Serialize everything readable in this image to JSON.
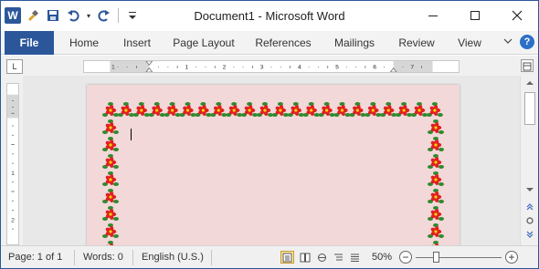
{
  "app": {
    "doc_name": "Document1",
    "separator": " - ",
    "app_name": "Microsoft Word",
    "word_icon_letter": "W"
  },
  "quick_access": {
    "icons": [
      "word-logo",
      "format-painter-icon",
      "save-icon",
      "undo-icon",
      "redo-icon",
      "customize-qat-icon"
    ]
  },
  "window_controls": {
    "minimize": "—",
    "maximize": "☐",
    "close": "✕"
  },
  "ribbon": {
    "tabs": [
      {
        "label": "File"
      },
      {
        "label": "Home"
      },
      {
        "label": "Insert"
      },
      {
        "label": "Page Layout"
      },
      {
        "label": "References"
      },
      {
        "label": "Mailings"
      },
      {
        "label": "Review"
      },
      {
        "label": "View"
      }
    ],
    "help_label": "?"
  },
  "ruler": {
    "horizontal_numbers": [
      "1",
      "1",
      "2",
      "3",
      "4",
      "5",
      "6",
      "7"
    ],
    "vertical_numbers": [
      "1",
      "2"
    ],
    "tab_selector": "L"
  },
  "document": {
    "page_color": "#f2d8d8",
    "border_style": "poinsettia flowers",
    "flower_colors": {
      "petal": "#e02020",
      "leaf": "#2f8a2f",
      "center": "#f5d400"
    }
  },
  "status_bar": {
    "page": "Page: 1 of 1",
    "words": "Words: 0",
    "language": "English (U.S.)",
    "zoom": "50%",
    "zoom_minus": "−",
    "zoom_plus": "+",
    "zoom_level": 50
  },
  "colors": {
    "accent": "#2b579a",
    "help": "#2b6fc7"
  }
}
